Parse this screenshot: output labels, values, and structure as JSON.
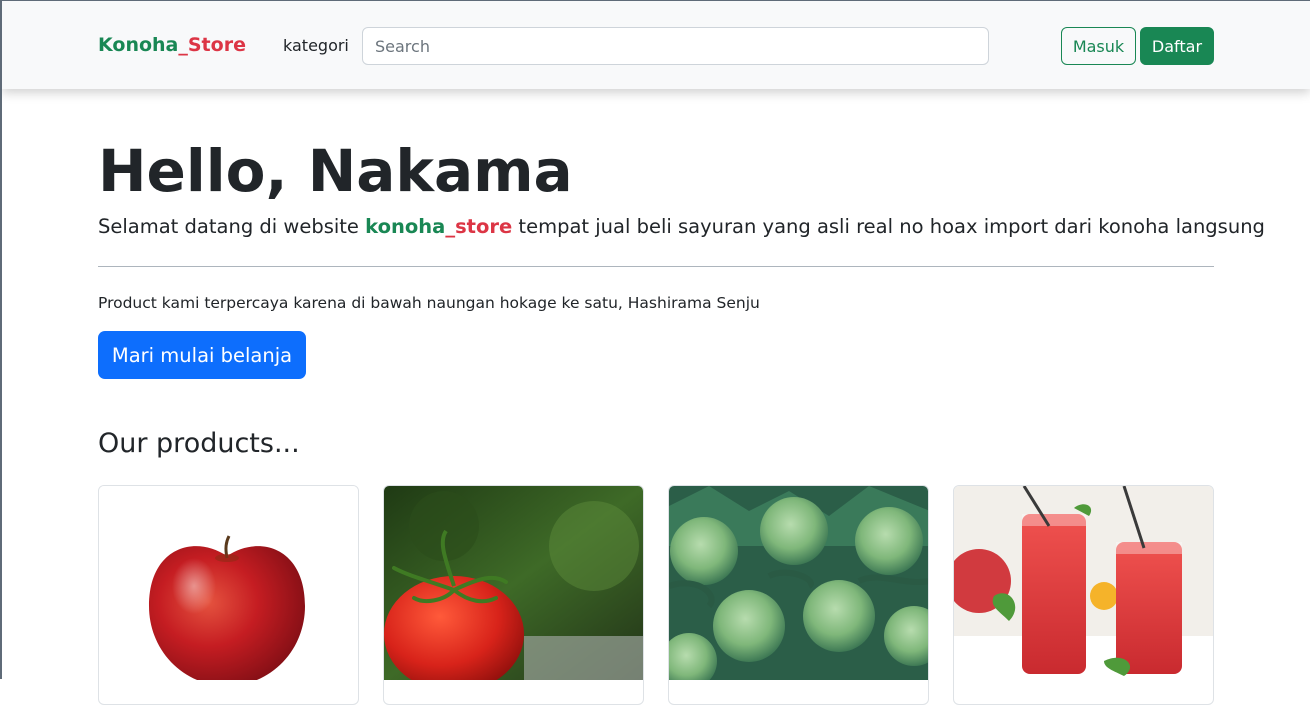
{
  "navbar": {
    "brand_part1": "Konoha",
    "brand_part2": "_Store",
    "kategori_label": "kategori",
    "search_placeholder": "Search",
    "search_value": "",
    "login_label": "Masuk",
    "register_label": "Daftar"
  },
  "hero": {
    "title": "Hello, Nakama",
    "lead_before": "Selamat datang di website ",
    "lead_brand_part1": "konoha",
    "lead_brand_part2": "_store",
    "lead_after": " tempat jual beli sayuran yang asli real no hoax import dari konoha langsung",
    "note": "Product kami terpercaya karena di bawah naungan hokage ke satu, Hashirama Senju",
    "cta_label": "Mari mulai belanja"
  },
  "products": {
    "section_title": "Our products...",
    "items": [
      {
        "image": "apple-image"
      },
      {
        "image": "tomato-image"
      },
      {
        "image": "cabbage-image"
      },
      {
        "image": "strawberry-juice-image"
      }
    ]
  },
  "colors": {
    "brand_green": "#198754",
    "brand_red": "#dc3545",
    "primary_blue": "#0d6efd",
    "navbar_bg": "#f8f9fa"
  }
}
